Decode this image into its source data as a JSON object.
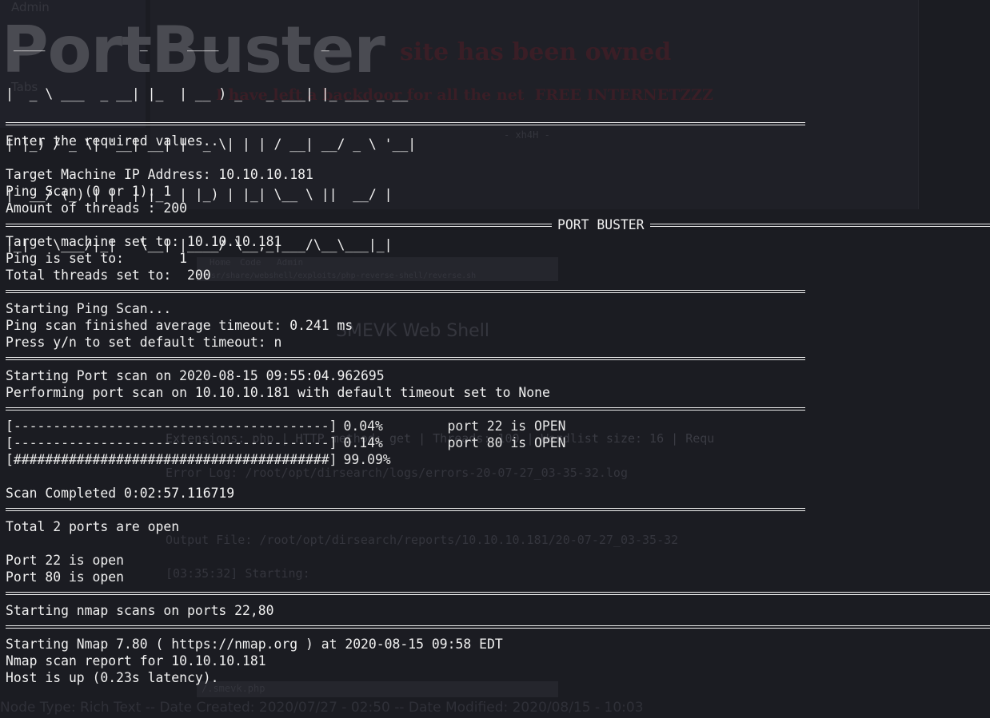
{
  "background": {
    "sidebar_items": [
      "Admin",
      "Tabs"
    ],
    "headline": "site has been owned",
    "subline": "I have left a backdoor for all the net  FREE INTERNETZZZ",
    "signature": "- xh4H -",
    "pills": [
      "Home",
      "Code",
      "Admin"
    ],
    "path_hint": "/usr/share/webshell/exploits/php-reverse-shell/reverse.sh",
    "section": "SMEVK Web Shell",
    "dirsearch_line": "Extensions: php | HTTP method: get | Threads: 100 | Wordlist size: 16 | Requ",
    "error_log": "Error Log: /root/opt/dirsearch/logs/errors-20-07-27_03-35-32.log",
    "output_file": "Output File: /root/opt/dirsearch/reports/10.10.10.181/20-07-27_03-35-32",
    "starting": "[03:35:32] Starting:",
    "footer_box": "/.smevk.php",
    "status_bar": "Node Type: Rich Text -- Date Created: 2020/07/27 - 02:50 -- Date Modified: 2020/08/15 - 10:03"
  },
  "logo": {
    "big_text": "PortBuster",
    "ascii": [
      " ____            _     ____             _",
      "|  _ \\ ___  _ __| |_  | __ ) _   _ ___| |_ ___ _ __",
      "| |_) / _ \\| '__| __| |  _ \\| | | / __| __/ _ \\ '__|",
      "|  __/ (_) | |  | |_  | |_) | |_| \\__ \\ ||  __/ |",
      "|_|   \\___/|_|   \\__| |____/ \\__,_|___/\\__\\___|_|"
    ]
  },
  "terminal": {
    "enter_values": "Enter the required values..",
    "target_prompt": "Target Machine IP Address: 10.10.10.181",
    "ping_prompt": "Ping Scan (0 or 1): 1",
    "threads_prompt": "Amount of threads : 200",
    "banner_label": "PORT BUSTER",
    "target_set": "Target machine set to: 10.10.10.181",
    "ping_set": "Ping is set to:       1",
    "threads_set": "Total threads set to:  200",
    "starting_ping": "Starting Ping Scan...",
    "ping_finished": "Ping scan finished average timeout: 0.241 ms",
    "press_yn": "Press y/n to set default timeout: n",
    "starting_port": "Starting Port scan on 2020-08-15 09:55:04.962695",
    "performing": "Performing port scan on 10.10.10.181 with default timeout set to None",
    "progress": [
      {
        "bar": "[----------------------------------------]",
        "percent": "0.04%",
        "message": "port 22 is OPEN"
      },
      {
        "bar": "[----------------------------------------]",
        "percent": "0.14%",
        "message": "port 80 is OPEN"
      },
      {
        "bar": "[########################################]",
        "percent": "99.09%",
        "message": ""
      }
    ],
    "scan_completed": "Scan Completed 0:02:57.116719",
    "total_open": "Total 2 ports are open",
    "port22": "Port 22 is open",
    "port80": "Port 80 is open",
    "nmap_start": "Starting nmap scans on ports 22,80",
    "nmap_version": "Starting Nmap 7.80 ( https://nmap.org ) at 2020-08-15 09:58 EDT",
    "nmap_report": "Nmap scan report for 10.10.10.181",
    "host_up": "Host is up (0.23s latency)."
  }
}
